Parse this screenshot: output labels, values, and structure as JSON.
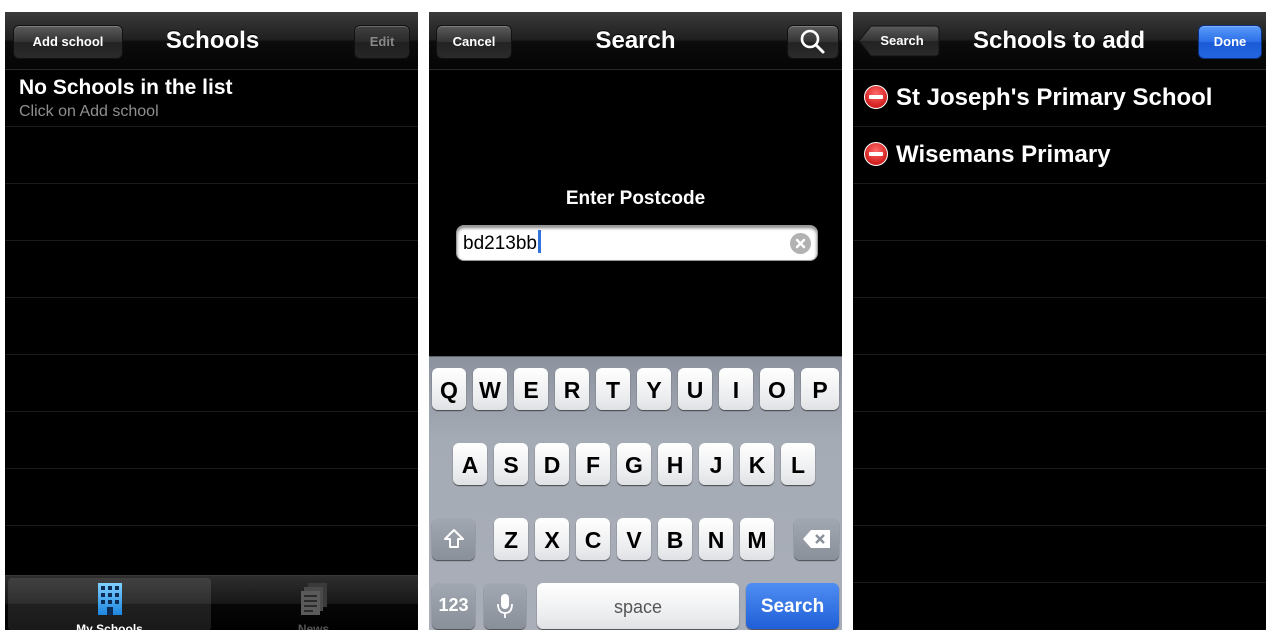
{
  "screen1": {
    "nav": {
      "left_button": "Add school",
      "title": "Schools",
      "right_button": "Edit"
    },
    "empty_state": {
      "title": "No Schools in the list",
      "subtitle": "Click on Add school"
    },
    "tabs": [
      {
        "label": "My Schools",
        "icon": "building-icon",
        "selected": true
      },
      {
        "label": "News",
        "icon": "news-documents-icon",
        "selected": false
      }
    ]
  },
  "screen2": {
    "nav": {
      "left_button": "Cancel",
      "title": "Search",
      "right_button_icon": "search-icon"
    },
    "prompt": "Enter Postcode",
    "postcode_value": "bd213bb",
    "keyboard": {
      "row1": [
        "Q",
        "W",
        "E",
        "R",
        "T",
        "Y",
        "U",
        "I",
        "O",
        "P"
      ],
      "row2": [
        "A",
        "S",
        "D",
        "F",
        "G",
        "H",
        "J",
        "K",
        "L"
      ],
      "row3": [
        "Z",
        "X",
        "C",
        "V",
        "B",
        "N",
        "M"
      ],
      "numbers_key": "123",
      "space_key": "space",
      "return_key": "Search"
    }
  },
  "screen3": {
    "nav": {
      "back_button": "Search",
      "title": "Schools to add",
      "right_button": "Done"
    },
    "schools": [
      {
        "name": "St Joseph's Primary School"
      },
      {
        "name": "Wisemans Primary"
      }
    ]
  },
  "colors": {
    "accent_blue": "#2a6ee8",
    "delete_red": "#d21f1f",
    "caret_blue": "#3272dc"
  }
}
